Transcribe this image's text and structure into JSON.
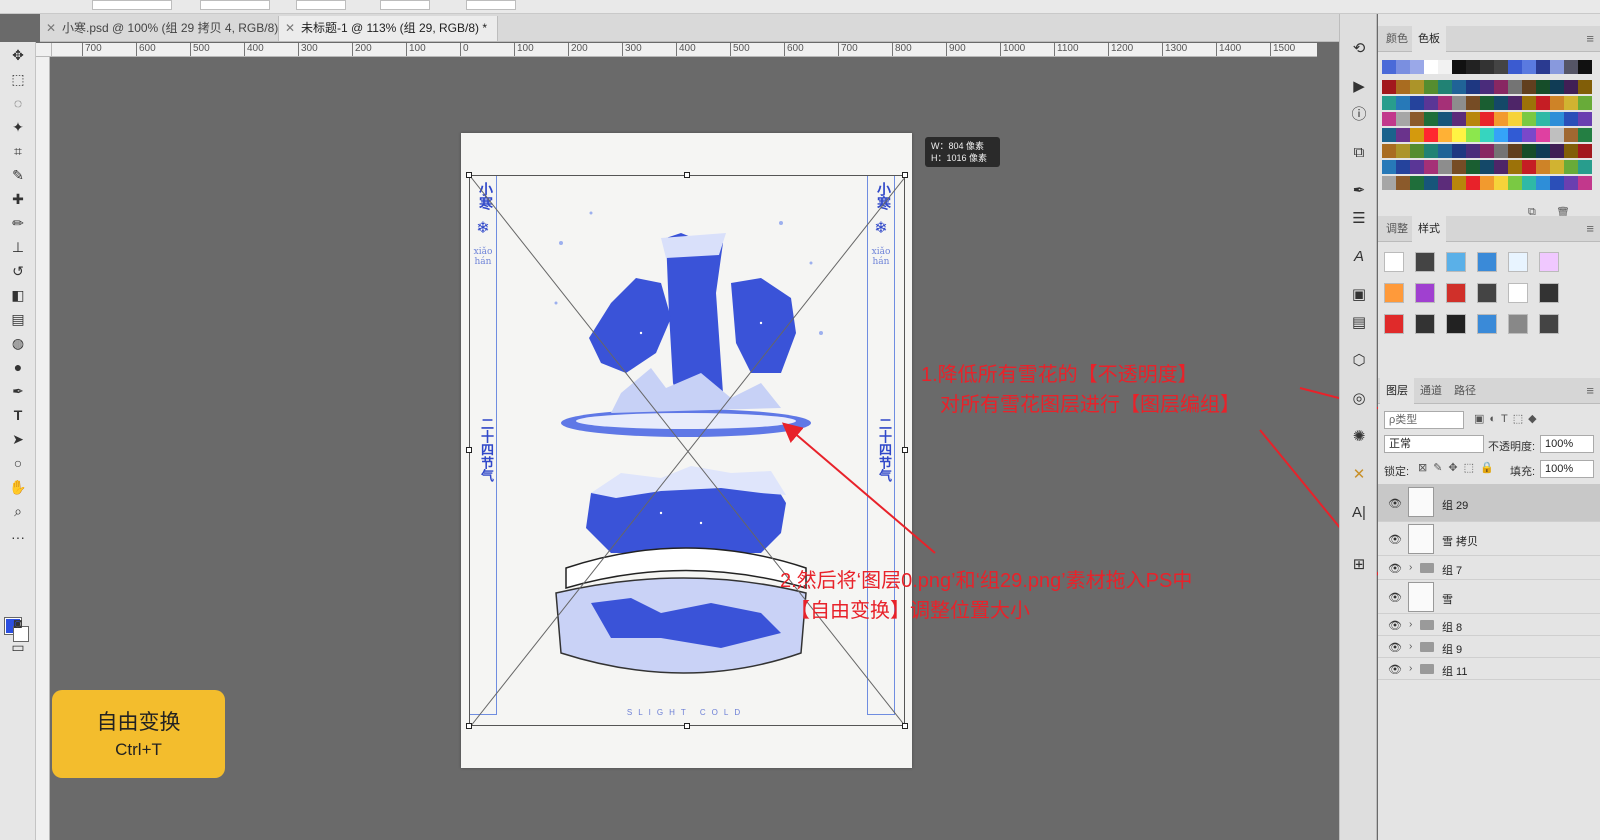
{
  "options_bar": {
    "note": ""
  },
  "tabs": [
    {
      "label": "小寒.psd @ 100% (组 29 拷贝 4, RGB/8)",
      "active": false
    },
    {
      "label": "未标题-1 @ 113% (组 29, RGB/8) *",
      "active": true
    }
  ],
  "ruler_ticks": [
    "700",
    "600",
    "500",
    "400",
    "300",
    "200",
    "100",
    "0",
    "100",
    "200",
    "300",
    "400",
    "500",
    "600",
    "700",
    "800",
    "900",
    "1000",
    "1100",
    "1200",
    "1300",
    "1400",
    "1500"
  ],
  "transform_tooltip": {
    "w": "W：804 像素",
    "h": "H：1016 像素"
  },
  "poster": {
    "side_top": "小寒",
    "side_pinyin": "xiǎo hán",
    "side_mid": "二十四节气",
    "footer": "SLIGHT COLD"
  },
  "shortcut_card": {
    "title": "自由变换",
    "keys": "Ctrl+T"
  },
  "annotations": {
    "line1": "1.降低所有雪花的【不透明度】",
    "line2": "对所有雪花图层进行【图层编组】",
    "line3": "2.然后将‘图层0.png’和‘组29.png’素材拖入PS中",
    "line4": "【自由变换】调整位置大小"
  },
  "swatches_panel": {
    "tabs": [
      "颜色",
      "色板"
    ],
    "active": "色板"
  },
  "adjust_panel": {
    "tabs": [
      "调整",
      "样式"
    ],
    "active": "样式"
  },
  "layers_panel": {
    "tabs": [
      "图层",
      "通道",
      "路径"
    ],
    "active": "图层",
    "filter_placeholder": "ρ类型",
    "blend_mode": "正常",
    "opacity_label": "不透明度:",
    "opacity_value": "100%",
    "lock_label": "锁定:",
    "fill_label": "填充:",
    "fill_value": "100%",
    "layers": [
      {
        "name": "组 29",
        "type": "smart",
        "selected": true
      },
      {
        "name": "雪 拷贝",
        "type": "smart",
        "selected": false
      },
      {
        "name": "组 7",
        "type": "group",
        "selected": false
      },
      {
        "name": "雪",
        "type": "smart",
        "selected": false
      },
      {
        "name": "组 8",
        "type": "group",
        "selected": false
      },
      {
        "name": "组 9",
        "type": "group",
        "selected": false
      },
      {
        "name": "组 11",
        "type": "group",
        "selected": false
      }
    ]
  },
  "colors": {
    "accent_red": "#e8222a",
    "poster_blue": "#3048c9",
    "card_yellow": "#f3bd2d"
  }
}
